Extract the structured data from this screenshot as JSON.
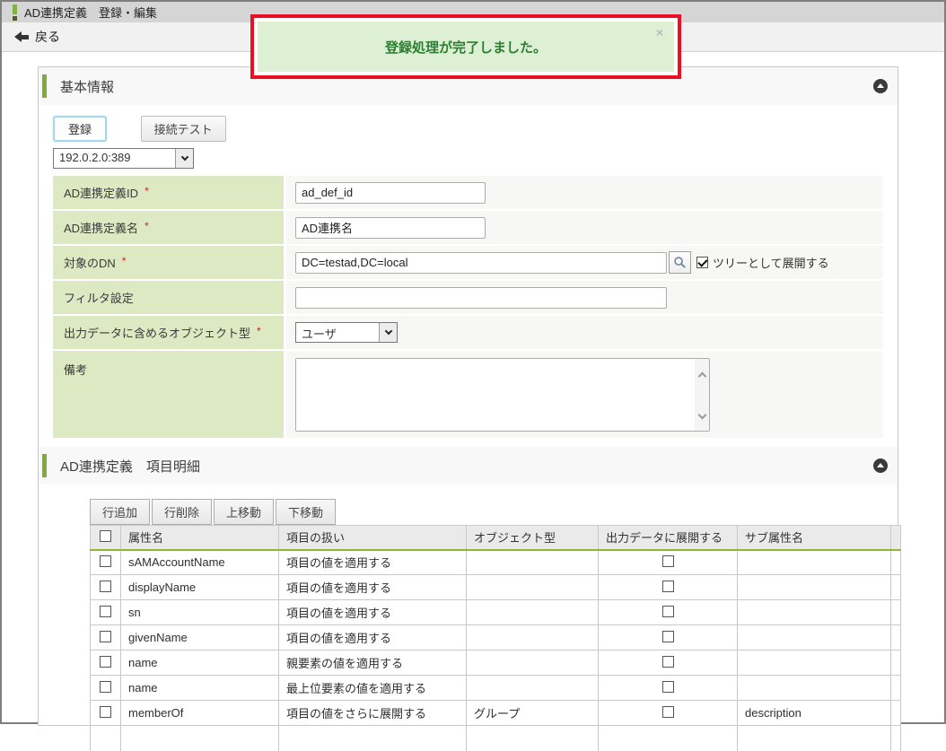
{
  "titlebar": {
    "title": "AD連携定義　登録・編集"
  },
  "toolbar": {
    "back_label": "戻る"
  },
  "icons": {
    "close": "×"
  },
  "required_mark": "*",
  "toast": {
    "message": "登録処理が完了しました。"
  },
  "basic": {
    "title": "基本情報",
    "register_button": "登録",
    "connection_test_button": "接続テスト",
    "server_select": {
      "value": "192.0.2.0:389"
    },
    "fields": {
      "def_id": {
        "label": "AD連携定義ID",
        "required": true,
        "value": "ad_def_id"
      },
      "def_name": {
        "label": "AD連携定義名",
        "required": true,
        "value": "AD連携名"
      },
      "target_dn": {
        "label": "対象のDN",
        "required": true,
        "value": "DC=testad,DC=local",
        "tree_checkbox_label": "ツリーとして展開する",
        "tree_checkbox_checked": true
      },
      "filter": {
        "label": "フィルタ設定",
        "required": false,
        "value": ""
      },
      "object_type": {
        "label": "出力データに含めるオブジェクト型",
        "required": true,
        "value": "ユーザ"
      },
      "note": {
        "label": "備考",
        "required": false,
        "value": ""
      }
    }
  },
  "detail": {
    "title": "AD連携定義　項目明細",
    "buttons": [
      "行追加",
      "行削除",
      "上移動",
      "下移動"
    ],
    "table": {
      "headers": [
        "属性名",
        "項目の扱い",
        "オブジェクト型",
        "出力データに展開する",
        "サブ属性名"
      ],
      "rows": [
        {
          "attr": "sAMAccountName",
          "handling": "項目の値を適用する",
          "object_type": "",
          "expand_checked": false,
          "sub_attr": ""
        },
        {
          "attr": "displayName",
          "handling": "項目の値を適用する",
          "object_type": "",
          "expand_checked": false,
          "sub_attr": ""
        },
        {
          "attr": "sn",
          "handling": "項目の値を適用する",
          "object_type": "",
          "expand_checked": false,
          "sub_attr": ""
        },
        {
          "attr": "givenName",
          "handling": "項目の値を適用する",
          "object_type": "",
          "expand_checked": false,
          "sub_attr": ""
        },
        {
          "attr": "name",
          "handling": "親要素の値を適用する",
          "object_type": "",
          "expand_checked": false,
          "sub_attr": ""
        },
        {
          "attr": "name",
          "handling": "最上位要素の値を適用する",
          "object_type": "",
          "expand_checked": false,
          "sub_attr": ""
        },
        {
          "attr": "memberOf",
          "handling": "項目の値をさらに展開する",
          "object_type": "グループ",
          "expand_checked": false,
          "sub_attr": "description"
        }
      ]
    }
  },
  "colors": {
    "accent_green": "#82a93c",
    "label_bg": "#dde9c3",
    "toast_bg": "#ddf0d3",
    "toast_text": "#2e7d32",
    "highlight_red": "#e81123"
  }
}
